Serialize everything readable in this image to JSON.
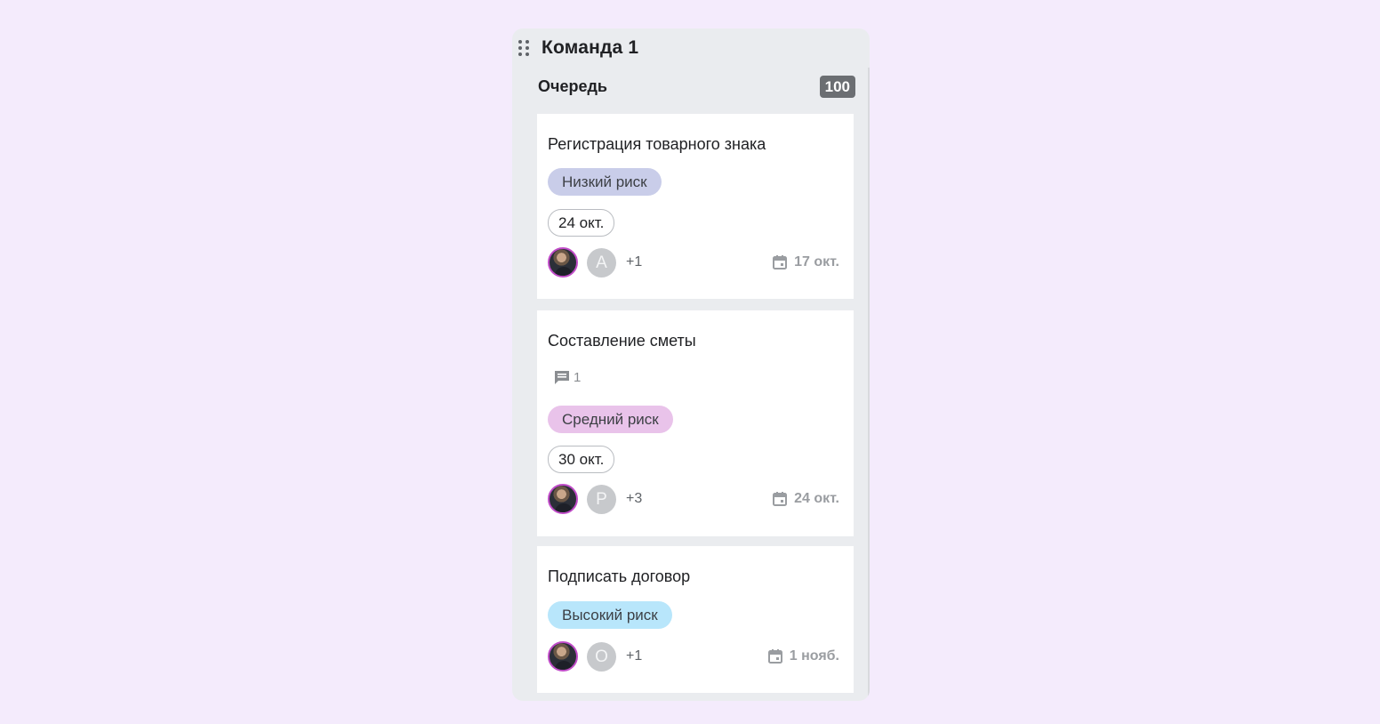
{
  "board": {
    "title": "Команда 1"
  },
  "column": {
    "title": "Очередь",
    "count": "100"
  },
  "colors": {
    "low_risk": "#c9cde9",
    "medium_risk": "#e9c3ea",
    "high_risk": "#b8e6fb",
    "avatar_border": "#c04cc8"
  },
  "cards": [
    {
      "title": "Регистрация товарного знака",
      "risk": "Низкий риск",
      "date_chip": "24 окт.",
      "avatar_letter": "А",
      "extra_assignees": "+1",
      "due_icon": "calendar-icon",
      "due": "17 окт."
    },
    {
      "title": "Составление сметы",
      "comments_icon": "comment-icon",
      "comments": "1",
      "risk": "Средний риск",
      "date_chip": "30 окт.",
      "avatar_letter": "Р",
      "extra_assignees": "+3",
      "due_icon": "calendar-icon",
      "due": "24 окт."
    },
    {
      "title": "Подписать договор",
      "risk": "Высокий риск",
      "avatar_letter": "О",
      "extra_assignees": "+1",
      "due_icon": "calendar-icon",
      "due": "1 нояб."
    }
  ]
}
